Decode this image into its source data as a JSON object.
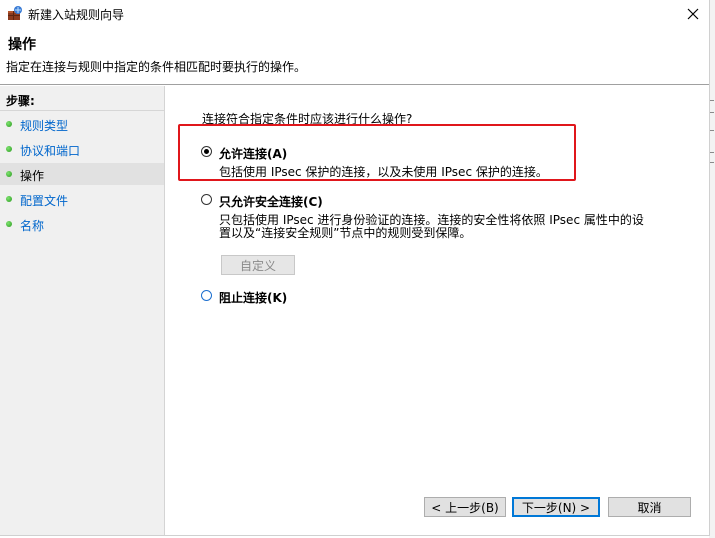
{
  "window": {
    "title": "新建入站规则向导",
    "close_glyph": "✕"
  },
  "header": {
    "title": "操作",
    "description": "指定在连接与规则中指定的条件相匹配时要执行的操作。"
  },
  "sidebar": {
    "steps_label": "步骤:",
    "items": [
      {
        "label": "规则类型",
        "active": false
      },
      {
        "label": "协议和端口",
        "active": false
      },
      {
        "label": "操作",
        "active": true
      },
      {
        "label": "配置文件",
        "active": false
      },
      {
        "label": "名称",
        "active": false
      }
    ]
  },
  "main": {
    "question": "连接符合指定条件时应该进行什么操作?",
    "options": [
      {
        "label": "允许连接(A)",
        "description": "包括使用 IPsec 保护的连接，以及未使用 IPsec 保护的连接。",
        "checked": true
      },
      {
        "label": "只允许安全连接(C)",
        "description_line1": "只包括使用 IPsec 进行身份验证的连接。连接的安全性将依照 IPsec 属性中的设",
        "description_line2": "置以及“连接安全规则”节点中的规则受到保障。",
        "checked": false,
        "customize_label": "自定义"
      },
      {
        "label": "阻止连接(K)",
        "checked": false
      }
    ],
    "highlight_color": "#e0161b"
  },
  "footer": {
    "back_label": "< 上一步(B)",
    "next_label": "下一步(N) >",
    "cancel_label": "取消"
  }
}
